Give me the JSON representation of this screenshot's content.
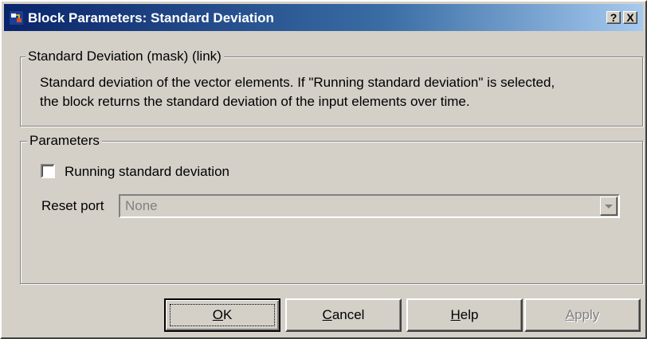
{
  "window": {
    "title": "Block Parameters: Standard Deviation",
    "help_glyph": "?",
    "close_glyph": "X",
    "icon": "simulink-block-icon"
  },
  "description": {
    "group_title": "Standard Deviation (mask) (link)",
    "lines": [
      "Standard deviation of the vector elements. If \"Running standard deviation\" is selected,",
      "the block returns the standard deviation of the input elements over time."
    ]
  },
  "parameters": {
    "group_title": "Parameters",
    "running_checkbox": {
      "label": "Running standard deviation",
      "checked": false
    },
    "reset_port": {
      "label": "Reset port",
      "value": "None",
      "enabled": false
    }
  },
  "buttons": {
    "ok": {
      "mnemonic": "O",
      "rest": "K"
    },
    "cancel": {
      "mnemonic": "C",
      "rest": "ancel"
    },
    "help": {
      "mnemonic": "H",
      "rest": "elp"
    },
    "apply": {
      "mnemonic": "A",
      "rest": "pply",
      "enabled": false
    }
  },
  "colors": {
    "title_gradient_start": "#0a246a",
    "title_gradient_end": "#a6caf0",
    "face": "#d4d0c8"
  }
}
